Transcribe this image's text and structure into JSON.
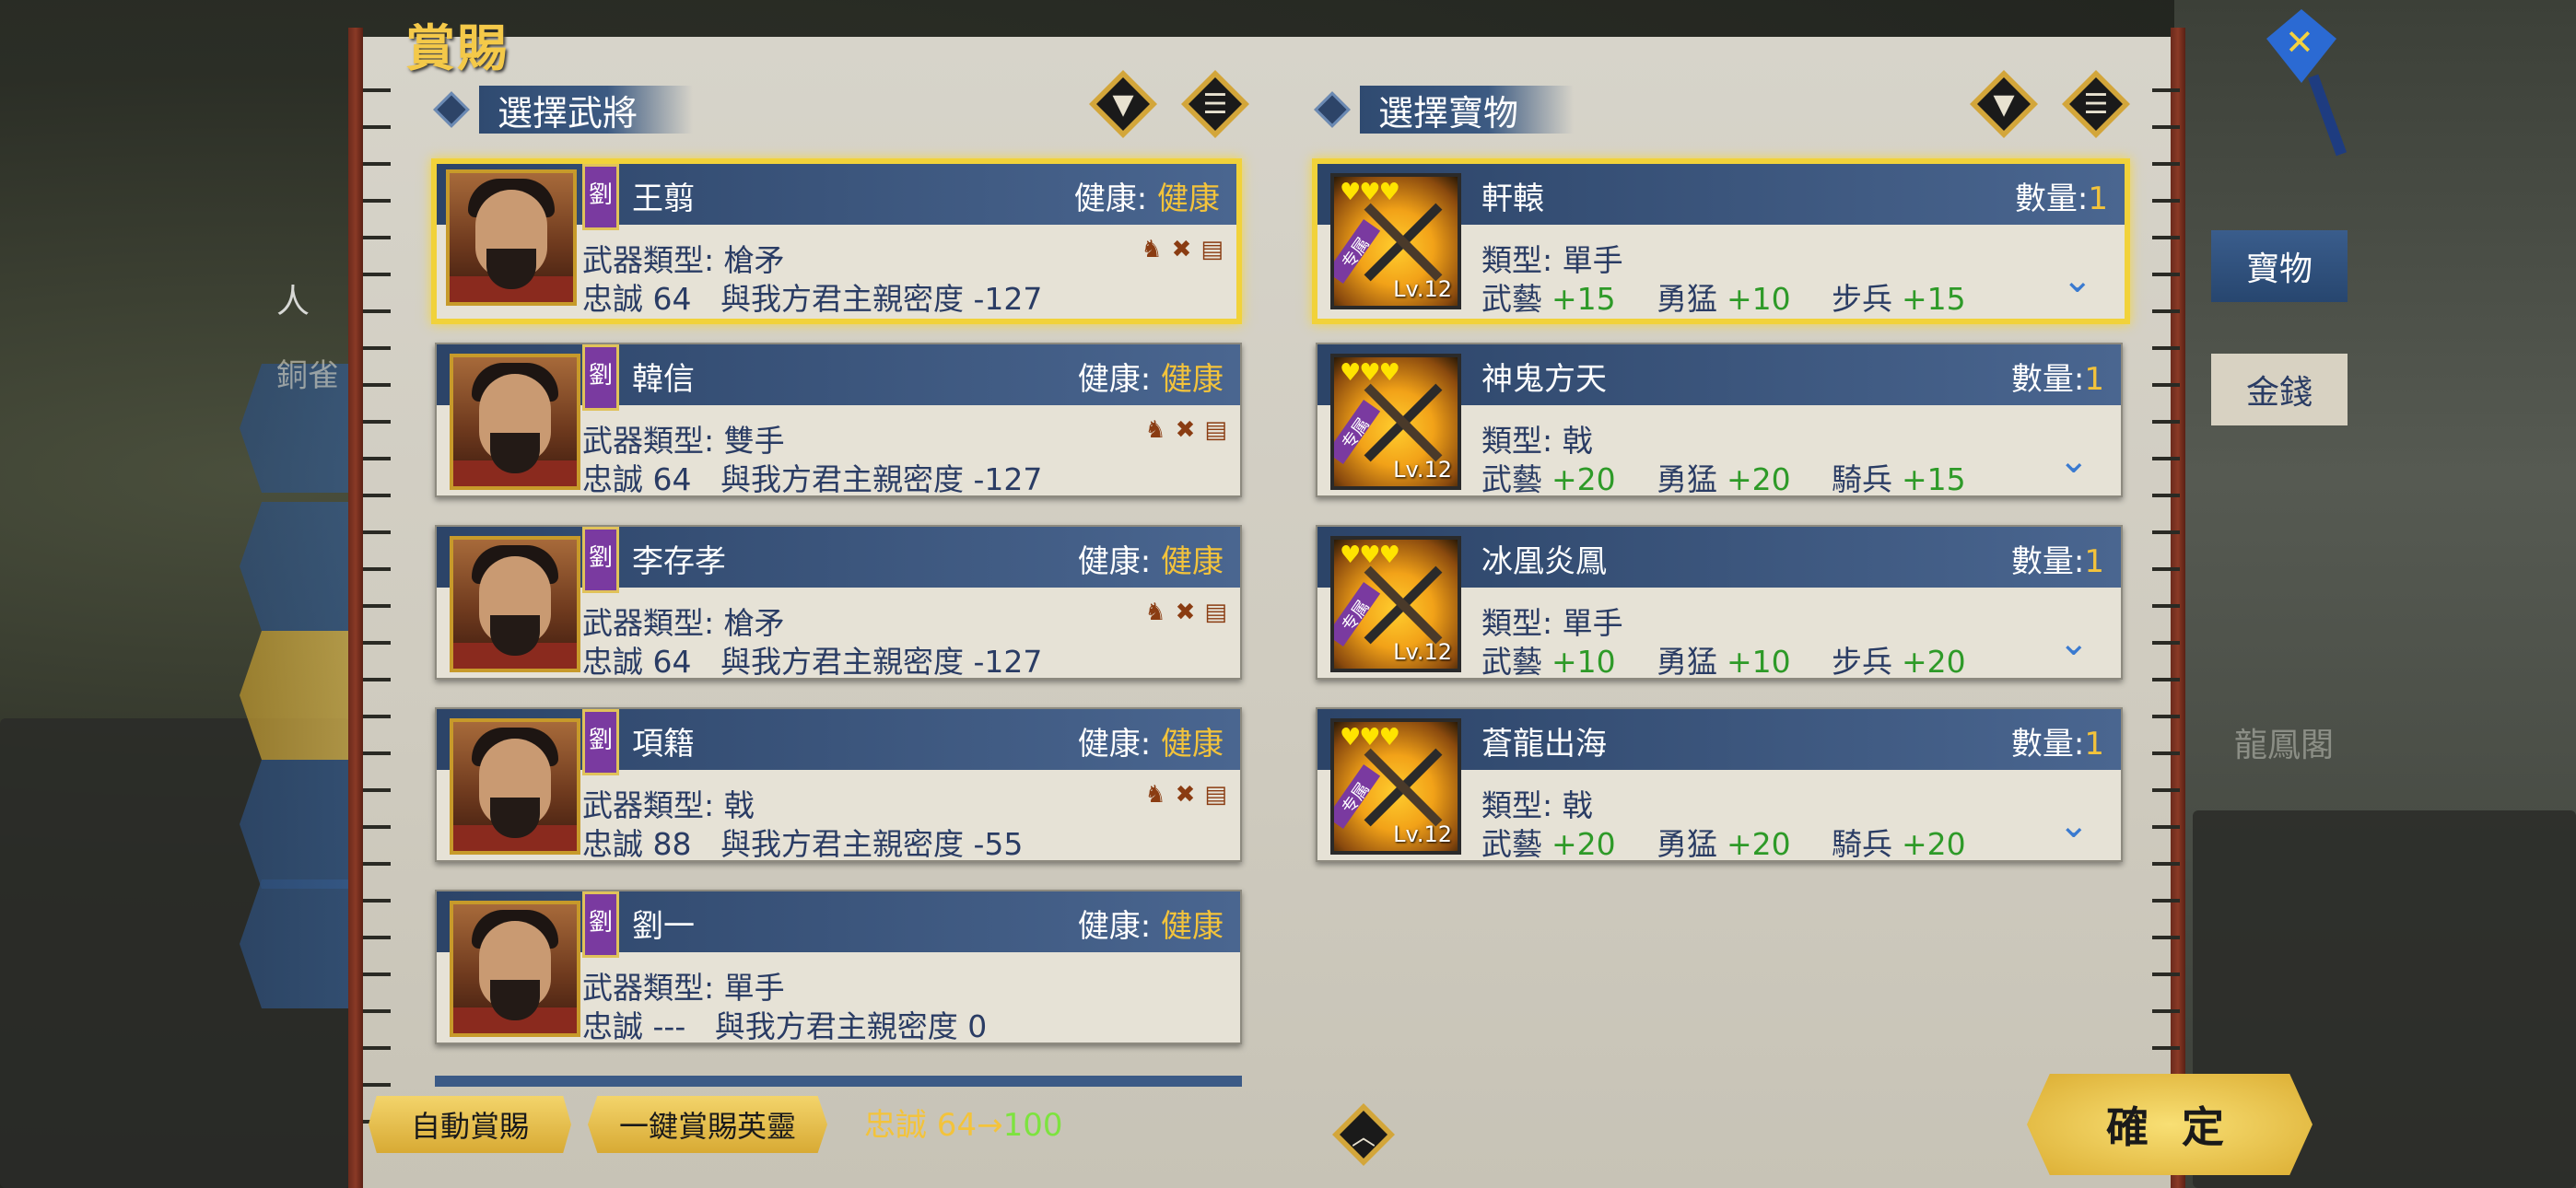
{
  "title": "賞賜",
  "left_section": {
    "label": "選擇武將"
  },
  "right_section": {
    "label": "選擇寶物"
  },
  "background_labels": {
    "left_tab": "人",
    "left_faded": "銅雀",
    "right_faded": "龍鳳閣"
  },
  "generals": [
    {
      "name": "王翦",
      "faction": "劉",
      "health_label": "健康:",
      "health": "健康",
      "weapon_label": "武器類型:",
      "weapon": "槍矛",
      "loyalty_label": "忠誠",
      "loyalty": "64",
      "intimacy_label": "與我方君主親密度",
      "intimacy": "-127",
      "selected": true
    },
    {
      "name": "韓信",
      "faction": "劉",
      "health_label": "健康:",
      "health": "健康",
      "weapon_label": "武器類型:",
      "weapon": "雙手",
      "loyalty_label": "忠誠",
      "loyalty": "64",
      "intimacy_label": "與我方君主親密度",
      "intimacy": "-127",
      "selected": false
    },
    {
      "name": "李存孝",
      "faction": "劉",
      "health_label": "健康:",
      "health": "健康",
      "weapon_label": "武器類型:",
      "weapon": "槍矛",
      "loyalty_label": "忠誠",
      "loyalty": "64",
      "intimacy_label": "與我方君主親密度",
      "intimacy": "-127",
      "selected": false
    },
    {
      "name": "項籍",
      "faction": "劉",
      "health_label": "健康:",
      "health": "健康",
      "weapon_label": "武器類型:",
      "weapon": "戟",
      "loyalty_label": "忠誠",
      "loyalty": "88",
      "intimacy_label": "與我方君主親密度",
      "intimacy": "-55",
      "selected": false
    },
    {
      "name": "劉一",
      "faction": "劉",
      "health_label": "健康:",
      "health": "健康",
      "weapon_label": "武器類型:",
      "weapon": "單手",
      "loyalty_label": "忠誠",
      "loyalty": "---",
      "intimacy_label": "與我方君主親密度",
      "intimacy": "0",
      "selected": false
    }
  ],
  "treasures": [
    {
      "name": "軒轅",
      "qty_label": "數量:",
      "qty": "1",
      "level": "Lv.12",
      "ribbon": "专属",
      "type_label": "類型:",
      "type": "單手",
      "stats": [
        {
          "k": "武藝",
          "v": "+15"
        },
        {
          "k": "勇猛",
          "v": "+10"
        },
        {
          "k": "步兵",
          "v": "+15"
        }
      ],
      "selected": true
    },
    {
      "name": "神鬼方天",
      "qty_label": "數量:",
      "qty": "1",
      "level": "Lv.12",
      "ribbon": "专属",
      "type_label": "類型:",
      "type": "戟",
      "stats": [
        {
          "k": "武藝",
          "v": "+20"
        },
        {
          "k": "勇猛",
          "v": "+20"
        },
        {
          "k": "騎兵",
          "v": "+15"
        }
      ],
      "selected": false
    },
    {
      "name": "冰凰炎鳳",
      "qty_label": "數量:",
      "qty": "1",
      "level": "Lv.12",
      "ribbon": "专属",
      "type_label": "類型:",
      "type": "單手",
      "stats": [
        {
          "k": "武藝",
          "v": "+10"
        },
        {
          "k": "勇猛",
          "v": "+10"
        },
        {
          "k": "步兵",
          "v": "+20"
        }
      ],
      "selected": false
    },
    {
      "name": "蒼龍出海",
      "qty_label": "數量:",
      "qty": "1",
      "level": "Lv.12",
      "ribbon": "专属",
      "type_label": "類型:",
      "type": "戟",
      "stats": [
        {
          "k": "武藝",
          "v": "+20"
        },
        {
          "k": "勇猛",
          "v": "+20"
        },
        {
          "k": "騎兵",
          "v": "+20"
        }
      ],
      "selected": false
    }
  ],
  "tabs": [
    {
      "label": "寶物",
      "active": true
    },
    {
      "label": "金錢",
      "active": false
    }
  ],
  "bottom": {
    "auto_reward": "自動賞賜",
    "one_key_reward": "一鍵賞賜英靈",
    "loyalty_label": "忠誠 64→",
    "loyalty_new": "100",
    "confirm": "確 定"
  },
  "colors": {
    "accent_gold": "#f3c33b",
    "stat_green": "#2e9a28",
    "header_blue": "#2c4468",
    "selected_border": "#f1d23a"
  }
}
